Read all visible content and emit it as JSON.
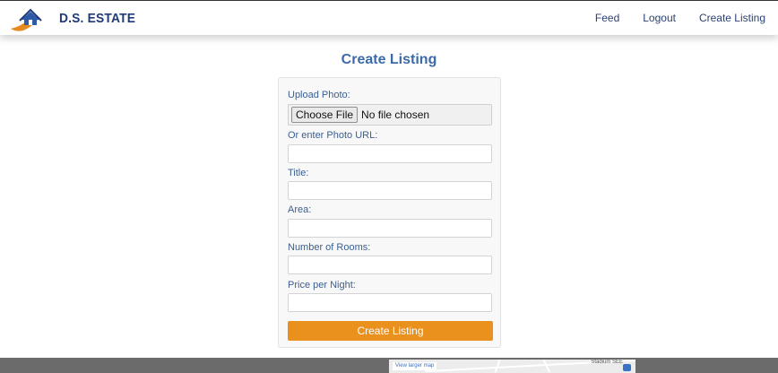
{
  "brand": {
    "name": "D.S. ESTATE"
  },
  "nav": {
    "links": [
      {
        "label": "Feed"
      },
      {
        "label": "Logout"
      },
      {
        "label": "Create Listing"
      }
    ]
  },
  "page": {
    "title": "Create Listing"
  },
  "form": {
    "upload_label": "Upload Photo:",
    "file_button": "Choose File",
    "file_status": "No file chosen",
    "photo_url_label": "Or enter Photo URL:",
    "photo_url_value": "",
    "title_label": "Title:",
    "title_value": "",
    "area_label": "Area:",
    "area_value": "",
    "rooms_label": "Number of Rooms:",
    "rooms_value": "",
    "price_label": "Price per Night:",
    "price_value": "",
    "submit_label": "Create Listing"
  },
  "footer": {
    "map": {
      "link": "View larger map",
      "label": "Stadium SEE"
    }
  },
  "colors": {
    "brand": "#1f3b7a",
    "title": "#3c6aa8",
    "accent": "#e9901d",
    "footer": "#6b6b6b"
  },
  "icons": {
    "logo": "house-logo-icon",
    "map_pin": "map-pin-icon"
  }
}
